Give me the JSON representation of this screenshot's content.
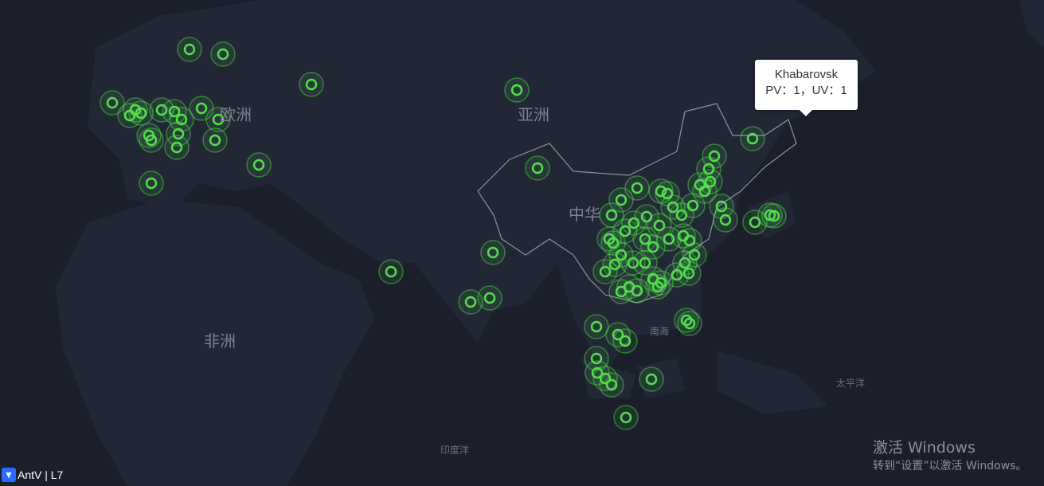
{
  "map": {
    "labels": {
      "europe": "欧洲",
      "asia": "亚洲",
      "africa": "非洲",
      "china": "中华",
      "south_sea": "南海",
      "pacific": "太平洋",
      "indian_ocean": "印度洋"
    },
    "marker_color": "#52e04a",
    "land_color": "#232837",
    "ocean_color": "#1b1f2b",
    "border_color": "#8f939c"
  },
  "tooltip": {
    "city": "Khabarovsk",
    "stats": "PV：1，UV：1"
  },
  "attribution": {
    "logo_text": "AntV | L7"
  },
  "watermark": {
    "line1": "激活 Windows",
    "line2": "转到“设置”以激活 Windows。"
  }
}
